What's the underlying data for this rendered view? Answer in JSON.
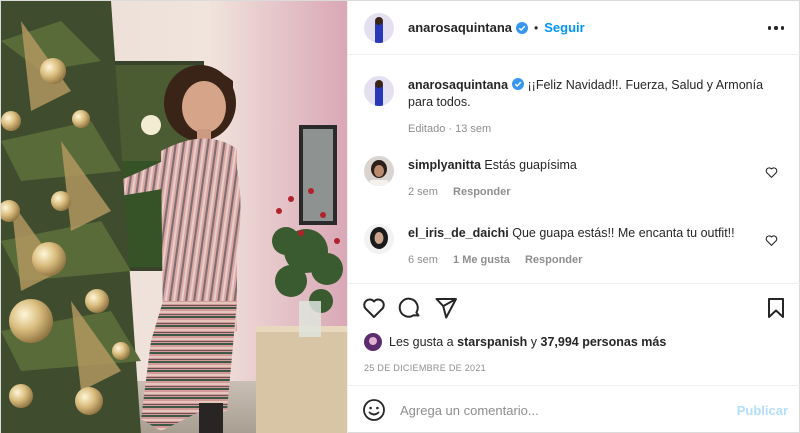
{
  "post": {
    "author": "anarosaquintana",
    "verified": true,
    "separator": "•",
    "follow_label": "Seguir",
    "more_icon": "more-horizontal-icon"
  },
  "caption": {
    "username": "anarosaquintana",
    "text": "¡¡Feliz Navidad!!. Fuerza, Salud y Armonía para todos.",
    "meta": "Editado · 13 sem"
  },
  "comments": [
    {
      "username": "simplyanitta",
      "text": "Estás guapísima",
      "time": "2 sem",
      "likes": "",
      "reply_label": "Responder"
    },
    {
      "username": "el_iris_de_daichi",
      "text": "Que guapa estás!! Me encanta tu outfit!!",
      "time": "6 sem",
      "likes": "1 Me gusta",
      "reply_label": "Responder"
    }
  ],
  "actions": {
    "like_icon": "heart-icon",
    "comment_icon": "comment-icon",
    "share_icon": "paper-plane-icon",
    "save_icon": "bookmark-icon"
  },
  "likes": {
    "prefix": "Les gusta a",
    "user": "starspanish",
    "middle": "y",
    "count": "37,994 personas más"
  },
  "date": "25 DE DICIEMBRE DE 2021",
  "add_comment": {
    "placeholder": "Agrega un comentario...",
    "publish_label": "Publicar",
    "emoji_icon": "emoji-icon"
  },
  "colors": {
    "link_blue": "#0095f6",
    "publish_disabled": "#b2dffc",
    "muted": "#8e8e8e",
    "verified_blue": "#3897f0"
  }
}
